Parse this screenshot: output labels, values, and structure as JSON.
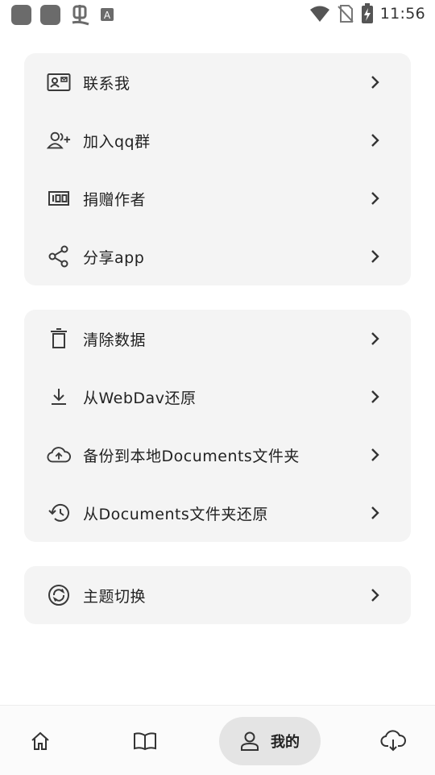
{
  "status_bar": {
    "time": "11:56",
    "icons": [
      "app-icon",
      "app-icon",
      "bug-icon",
      "font-icon",
      "wifi-icon",
      "no-sim-icon",
      "battery-charging-icon"
    ]
  },
  "groups": [
    {
      "items": [
        {
          "label": "联系我",
          "icon": "contact-card-icon"
        },
        {
          "label": "加入qq群",
          "icon": "add-group-icon"
        },
        {
          "label": "捐赠作者",
          "icon": "donate-icon"
        },
        {
          "label": "分享app",
          "icon": "share-icon"
        }
      ]
    },
    {
      "items": [
        {
          "label": "清除数据",
          "icon": "trash-icon"
        },
        {
          "label": "从WebDav还原",
          "icon": "download-icon"
        },
        {
          "label": "备份到本地Documents文件夹",
          "icon": "cloud-upload-icon"
        },
        {
          "label": "从Documents文件夹还原",
          "icon": "history-icon"
        }
      ]
    },
    {
      "items": [
        {
          "label": "主题切换",
          "icon": "theme-switch-icon"
        }
      ]
    }
  ],
  "bottom_nav": {
    "items": [
      {
        "icon": "home-icon"
      },
      {
        "icon": "book-icon"
      },
      {
        "label": "我的",
        "icon": "person-icon",
        "selected": true
      },
      {
        "icon": "cloud-download-icon"
      }
    ]
  },
  "colors": {
    "card_bg": "#f4f4f4",
    "selected_pill": "#e4e4e4",
    "icon": "#3a3a3a"
  }
}
